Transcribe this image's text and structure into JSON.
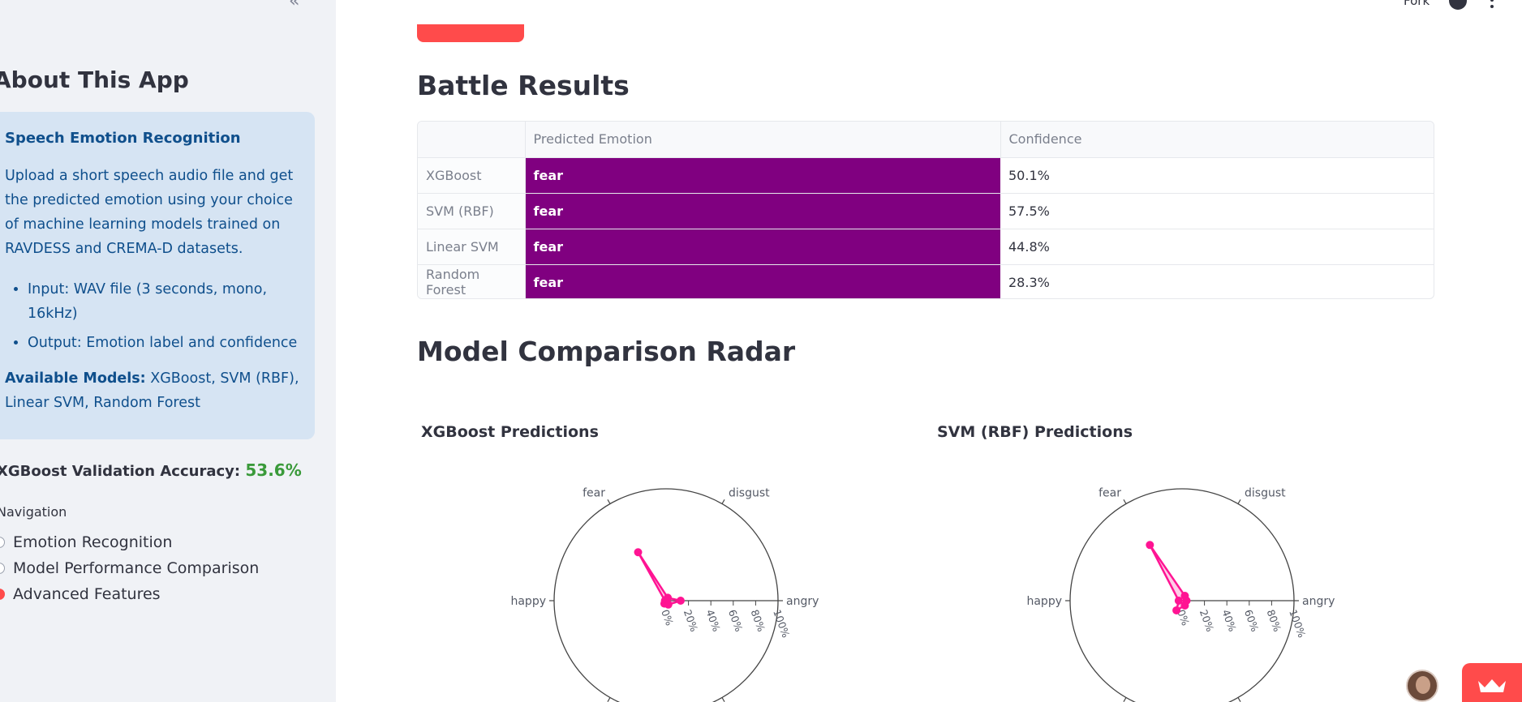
{
  "sidebar": {
    "collapse_icon": "double-chevron-left-icon",
    "title": "About This App",
    "info": {
      "heading": "Speech Emotion Recognition",
      "paragraph": "Upload a short speech audio file and get the predicted emotion using your choice of machine learning models trained on RAVDESS and CREMA-D datasets.",
      "bullets": [
        "Input: WAV file (3 seconds, mono, 16kHz)",
        "Output: Emotion label and confidence"
      ],
      "models_label": "Available Models:",
      "models_value": " XGBoost, SVM (RBF), Linear SVM, Random Forest"
    },
    "accuracy_label": "XGBoost Validation Accuracy: ",
    "accuracy_value": "53.6%",
    "nav_label": "Navigation",
    "nav_options": [
      "Emotion Recognition",
      "Model Performance Comparison",
      "Advanced Features"
    ],
    "nav_selected": "Advanced Features"
  },
  "header": {
    "fork_label": "Fork",
    "github_icon": "github-icon",
    "menu_icon": "more-vertical-icon"
  },
  "main": {
    "battle_title": "Battle Results",
    "table": {
      "columns": [
        "",
        "Predicted Emotion",
        "Confidence"
      ],
      "rows": [
        {
          "model": "XGBoost",
          "emotion": "fear",
          "confidence": "50.1%"
        },
        {
          "model": "SVM (RBF)",
          "emotion": "fear",
          "confidence": "57.5%"
        },
        {
          "model": "Linear SVM",
          "emotion": "fear",
          "confidence": "44.8%"
        },
        {
          "model": "Random Forest",
          "emotion": "fear",
          "confidence": "28.3%"
        }
      ],
      "highlight_color": "#800080"
    },
    "radar_title": "Model Comparison Radar",
    "radars": [
      {
        "title": "XGBoost Predictions",
        "values": {
          "angry": 0.13,
          "disgust": 0.03,
          "fear": 0.5,
          "happy": 0.01,
          "neutral": 0.03,
          "sad": 0.04
        }
      },
      {
        "title": "SVM (RBF) Predictions",
        "values": {
          "angry": 0.04,
          "disgust": 0.05,
          "fear": 0.575,
          "happy": 0.03,
          "neutral": 0.1,
          "sad": 0.05
        }
      }
    ],
    "radar_labels": {
      "fear": "fear",
      "disgust": "disgust",
      "happy": "happy",
      "angry": "angry"
    },
    "radial_ticks": [
      "0%",
      "20%",
      "40%",
      "60%",
      "80%",
      "100%"
    ],
    "accent_color": "#ff4b4b",
    "radar_color": "#ff1493"
  }
}
